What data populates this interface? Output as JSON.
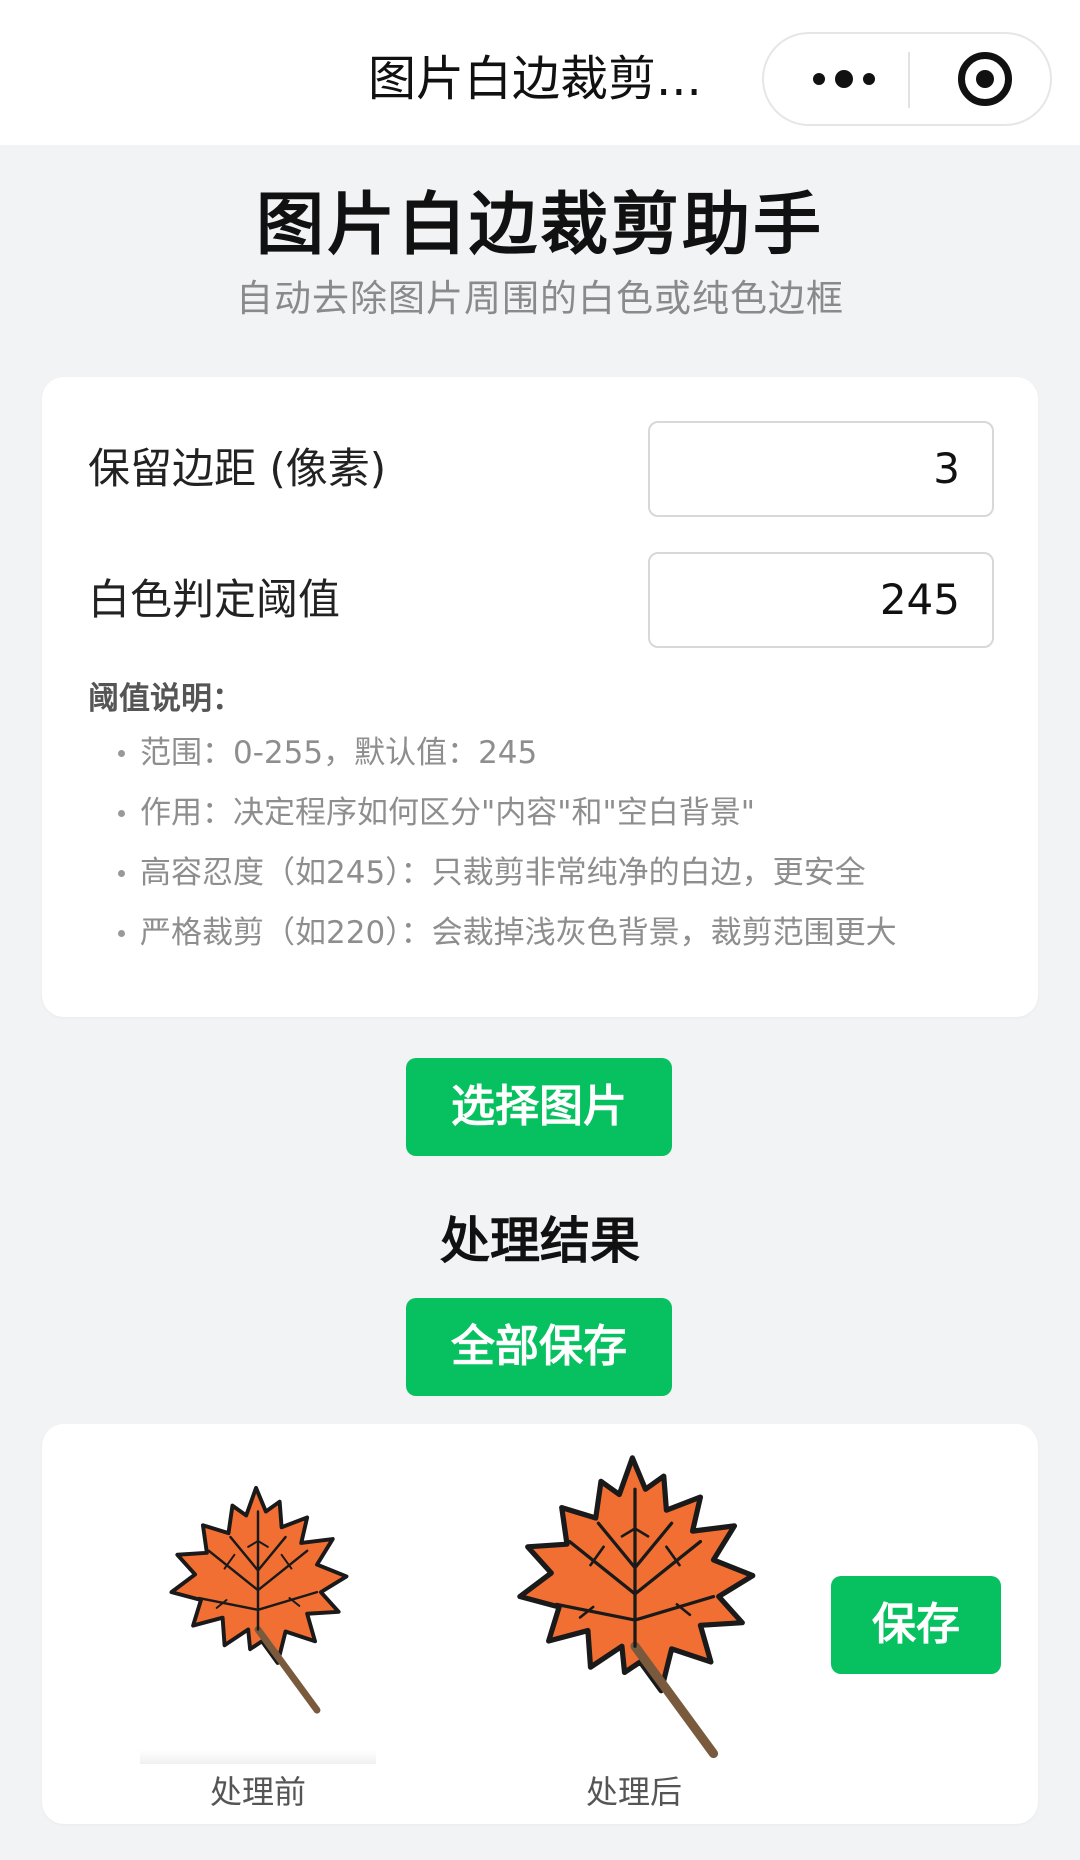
{
  "navbar": {
    "title": "图片白边裁剪...",
    "more_icon": "more-dots-icon",
    "close_icon": "target-circle-icon"
  },
  "header": {
    "title": "图片白边裁剪助手",
    "subtitle": "自动去除图片周围的白色或纯色边框"
  },
  "settings": {
    "margin_label": "保留边距 (像素)",
    "margin_value": "3",
    "threshold_label": "白色判定阈值",
    "threshold_value": "245",
    "note_heading": "阈值说明：",
    "notes": [
      "范围：0-255，默认值：245",
      "作用：决定程序如何区分\"内容\"和\"空白背景\"",
      "高容忍度（如245）：只裁剪非常纯净的白边，更安全",
      "严格裁剪（如220）：会裁掉浅灰色背景，裁剪范围更大"
    ]
  },
  "actions": {
    "select_label": "选择图片",
    "results_heading": "处理结果",
    "save_all_label": "全部保存"
  },
  "result": {
    "before_caption": "处理前",
    "after_caption": "处理后",
    "save_label": "保存",
    "leaf_color": "#f26f33",
    "outline_color": "#1a1a1a",
    "stem_color": "#7a5a3c"
  },
  "colors": {
    "accent": "#07c160",
    "background": "#f2f3f5"
  }
}
